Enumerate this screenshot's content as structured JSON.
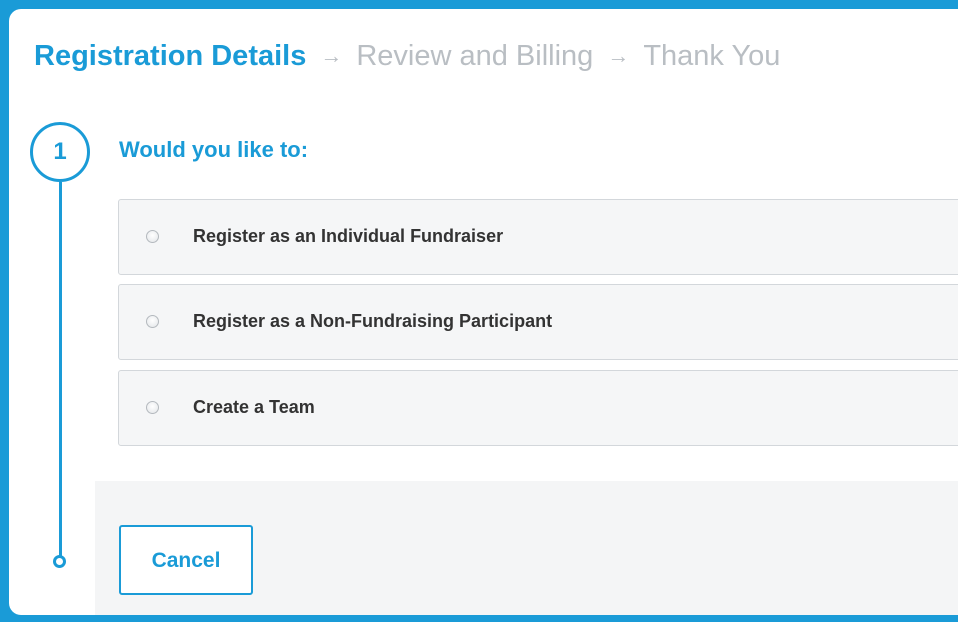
{
  "steps": [
    {
      "label": "Registration Details",
      "state": "active"
    },
    {
      "label": "Review and Billing",
      "state": "upcoming"
    },
    {
      "label": "Thank You",
      "state": "upcoming"
    }
  ],
  "arrow_glyph": "→",
  "section": {
    "number": "1",
    "question": "Would you like to:"
  },
  "options": [
    {
      "label": "Register as an Individual Fundraiser",
      "selected": false
    },
    {
      "label": "Register as a Non-Fundraising Participant",
      "selected": false
    },
    {
      "label": "Create a Team",
      "selected": false
    }
  ],
  "footer": {
    "cancel_label": "Cancel"
  },
  "colors": {
    "accent": "#1a9bd7",
    "inactive_step": "#b9bec3",
    "option_bg": "#f5f6f7",
    "text": "#333333"
  },
  "icons": {
    "arrow": "arrow-right-icon",
    "radio": "radio-unchecked-icon"
  }
}
